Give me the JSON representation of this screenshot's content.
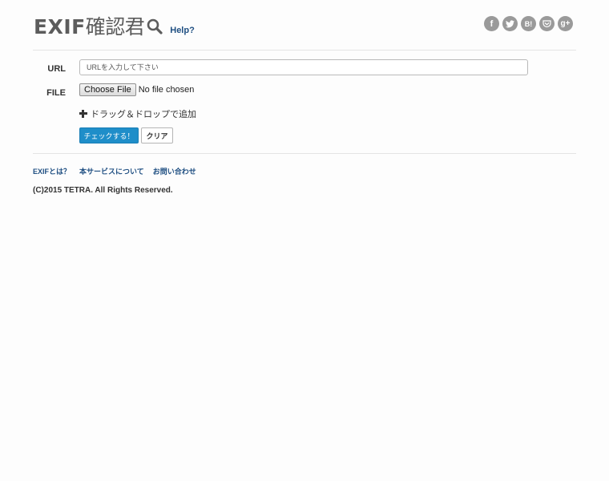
{
  "header": {
    "logo_latin": "EXIF",
    "logo_jp": "確認君",
    "help_label": "Help?",
    "icon_color": "#5c5c5c",
    "link_color": "#1f4f82"
  },
  "social": [
    {
      "name": "facebook",
      "glyph": "f"
    },
    {
      "name": "twitter",
      "glyph": ""
    },
    {
      "name": "hatena",
      "glyph": "B!"
    },
    {
      "name": "pocket",
      "glyph": ""
    },
    {
      "name": "google-plus",
      "glyph": "g+"
    }
  ],
  "form": {
    "url_label": "URL",
    "url_placeholder": "URLを入力して下さい",
    "url_value": "",
    "file_label": "FILE",
    "file_button_label": "Choose File",
    "file_status": "No file chosen",
    "dropzone_label": "ドラッグ＆ドロップで追加",
    "check_button_label": "チェックする！",
    "clear_button_label": "クリア",
    "primary_color": "#1f8ec9"
  },
  "footer": {
    "links": [
      "EXIFとは？",
      "本サービスについて",
      "お問い合わせ"
    ],
    "copyright": "(C)2015 TETRA. All Rights Reserved."
  }
}
